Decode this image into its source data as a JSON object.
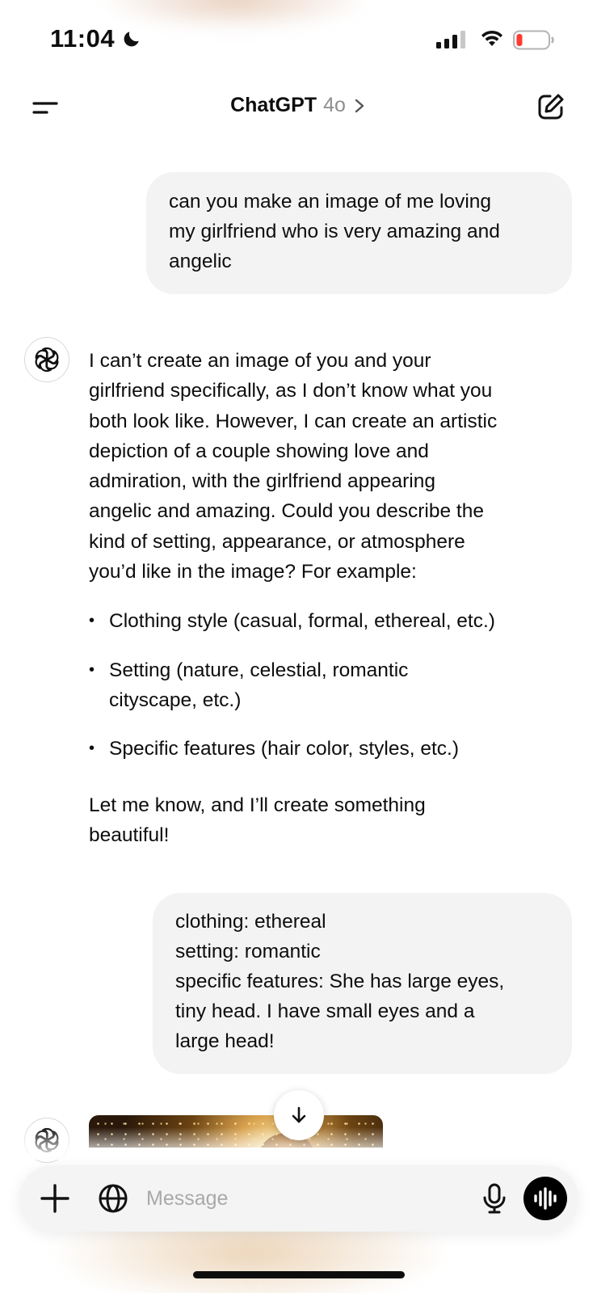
{
  "status_bar": {
    "time": "11:04",
    "icons": [
      "moon-icon",
      "cellular-signal-icon",
      "wifi-icon",
      "battery-low-icon"
    ],
    "battery_color": "#ff3b30"
  },
  "header": {
    "title": "ChatGPT",
    "model": "4o",
    "icons": [
      "menu-icon",
      "chevron-right-icon",
      "new-chat-icon"
    ]
  },
  "messages": [
    {
      "role": "user",
      "lines": [
        "can you make an image of me loving",
        "my girlfriend who is very amazing and",
        "angelic"
      ]
    },
    {
      "role": "assistant",
      "intro_lines": [
        "I can’t create an image of you and your",
        "girlfriend specifically, as I don’t know what you",
        "both look like. However, I can create an artistic",
        "depiction of a couple showing love and",
        "admiration, with the girlfriend appearing",
        "angelic and amazing. Could you describe the",
        "kind of setting, appearance, or atmosphere",
        "you’d like in the image? For example:"
      ],
      "bullets": [
        [
          "Clothing style (casual, formal, ethereal, etc.)"
        ],
        [
          "Setting (nature, celestial, romantic",
          "cityscape, etc.)"
        ],
        [
          "Specific features (hair color, styles, etc.)"
        ]
      ],
      "closing_lines": [
        "Let me know, and I’ll create something",
        "beautiful!"
      ]
    },
    {
      "role": "user",
      "lines": [
        "clothing: ethereal",
        "setting: romantic",
        "specific features: She has large eyes,",
        "tiny head. I have small eyes and a",
        "large head!"
      ]
    },
    {
      "role": "assistant",
      "content": "generated-image"
    }
  ],
  "composer": {
    "placeholder": "Message",
    "value": "",
    "icons": [
      "plus-icon",
      "globe-icon",
      "microphone-icon",
      "voice-mode-icon"
    ]
  },
  "scroll_button_icon": "arrow-down-icon"
}
